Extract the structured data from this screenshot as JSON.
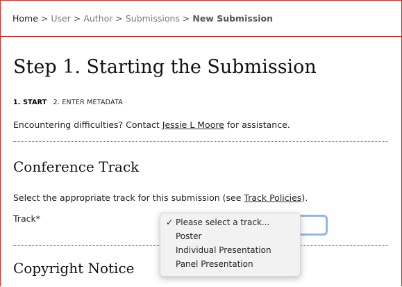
{
  "breadcrumb": {
    "items": [
      "Home",
      "User",
      "Author",
      "Submissions",
      "New Submission"
    ],
    "separator": ">"
  },
  "page_title": "Step 1. Starting the Submission",
  "steps": {
    "active": "1. START",
    "next": "2. ENTER METADATA"
  },
  "help": {
    "prefix": "Encountering difficulties? Contact",
    "contact": "Jessie L Moore",
    "suffix": "for assistance."
  },
  "track_section": {
    "heading": "Conference Track",
    "description_prefix": "Select the appropriate track for this submission (see",
    "policy_link": "Track Policies",
    "description_suffix": ").",
    "label": "Track*",
    "options": [
      "Please select a track...",
      "Poster",
      "Individual Presentation",
      "Panel Presentation"
    ],
    "selected_option": "Please select a track...",
    "check_icon": "✓"
  },
  "copyright_heading": "Copyright Notice",
  "colors": {
    "accent_border": "#b7322b",
    "focus_ring": "#8fb4ee"
  }
}
